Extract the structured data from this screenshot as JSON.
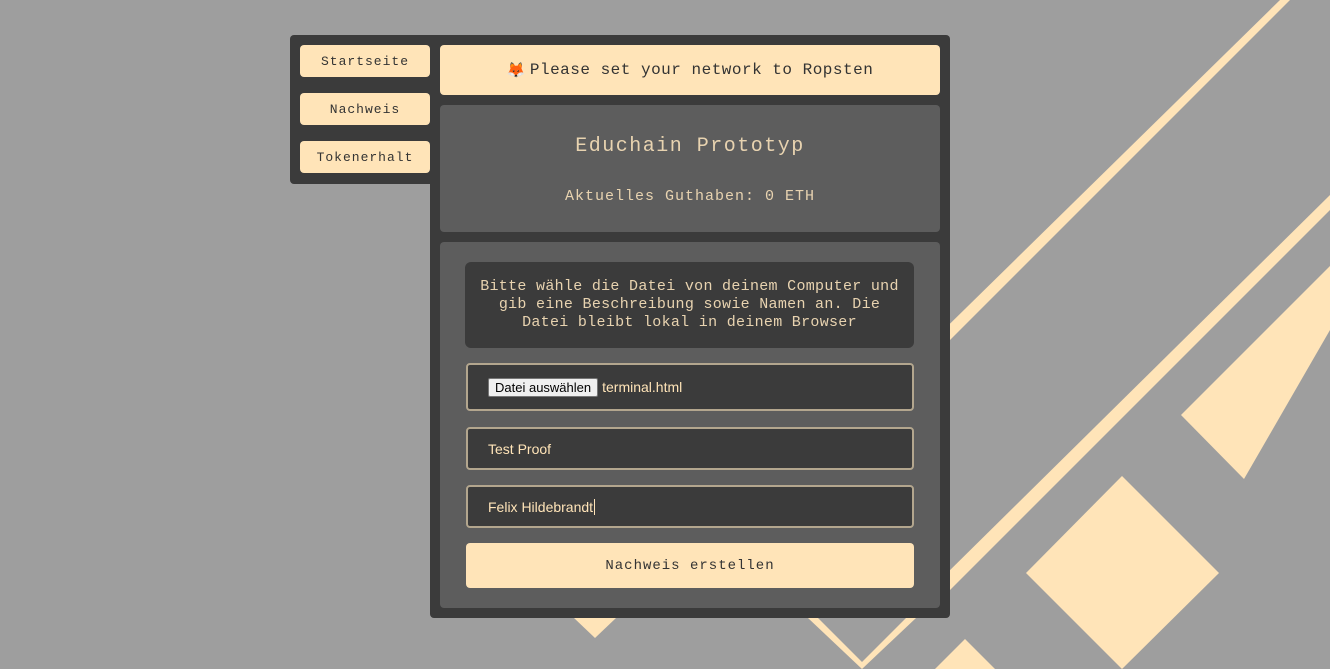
{
  "colors": {
    "background": "#9e9e9e",
    "accent": "#ffe4b8",
    "panel_dark": "#3b3b3b",
    "panel_mid": "#5d5d5d",
    "text_light": "#e8d3b0"
  },
  "sidebar": {
    "items": [
      {
        "label": "Startseite"
      },
      {
        "label": "Nachweis"
      },
      {
        "label": "Tokenerhalt"
      }
    ]
  },
  "banner": {
    "icon": "fox-icon",
    "text": "Please set your network to Ropsten"
  },
  "info": {
    "title": "Educhain Prototyp",
    "balance": "Aktuelles Guthaben: 0 ETH"
  },
  "form": {
    "description": "Bitte wähle die Datei von deinem Computer und gib eine Beschreibung sowie Namen an. Die Datei bleibt lokal in deinem Browser",
    "file_button_label": "Datei auswählen",
    "file_name": "terminal.html",
    "description_value": "Test Proof",
    "name_value": "Felix Hildebrandt",
    "submit_label": "Nachweis erstellen"
  }
}
